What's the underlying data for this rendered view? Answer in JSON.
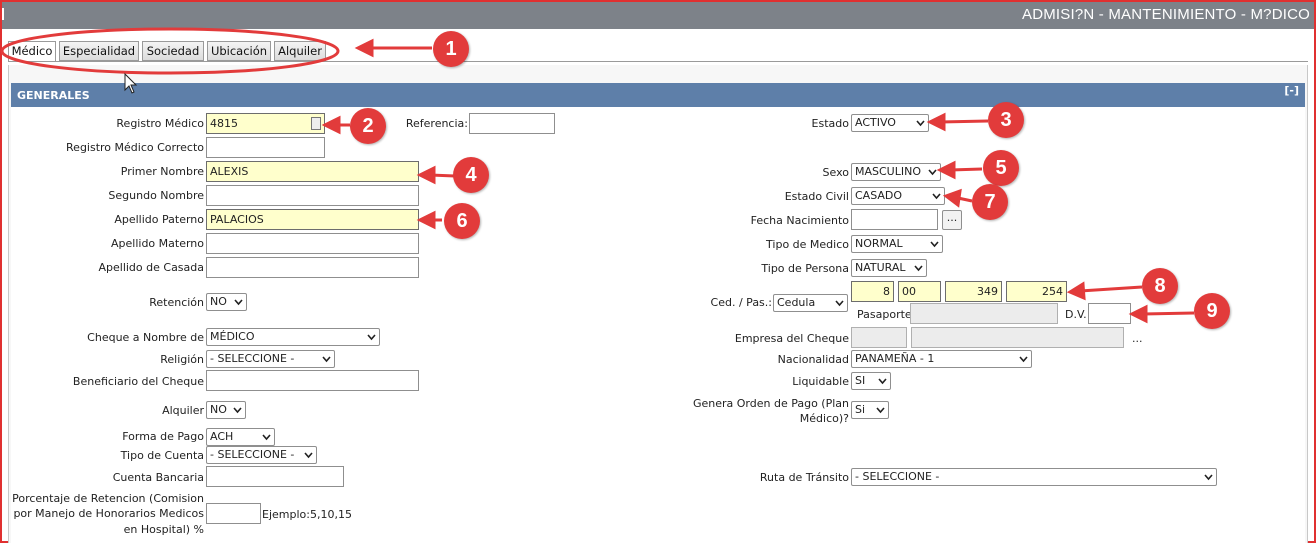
{
  "window": {
    "title": "ADMISI?N - MANTENIMIENTO - M?DICO"
  },
  "tabs": [
    {
      "label": "Médico",
      "active": true
    },
    {
      "label": "Especialidad"
    },
    {
      "label": "Sociedad"
    },
    {
      "label": "Ubicación"
    },
    {
      "label": "Alquiler"
    }
  ],
  "panel": {
    "title": "GENERALES",
    "collapse_label": "[-]"
  },
  "left": {
    "registro_medico": {
      "label": "Registro Médico",
      "value": "4815"
    },
    "referencia": {
      "label": "Referencia:",
      "value": ""
    },
    "registro_correcto": {
      "label": "Registro Médico Correcto",
      "value": ""
    },
    "primer_nombre": {
      "label": "Primer Nombre",
      "value": "ALEXIS"
    },
    "segundo_nombre": {
      "label": "Segundo Nombre",
      "value": ""
    },
    "apellido_paterno": {
      "label": "Apellido Paterno",
      "value": "PALACIOS"
    },
    "apellido_materno": {
      "label": "Apellido Materno",
      "value": ""
    },
    "apellido_casada": {
      "label": "Apellido de Casada",
      "value": ""
    },
    "retencion": {
      "label": "Retención",
      "value": "NO"
    },
    "cheque_nombre": {
      "label": "Cheque a Nombre de",
      "value": "MÉDICO"
    },
    "religion": {
      "label": "Religión",
      "value": "- SELECCIONE -"
    },
    "beneficiario": {
      "label": "Beneficiario del Cheque",
      "value": ""
    },
    "alquiler": {
      "label": "Alquiler",
      "value": "NO"
    },
    "forma_pago": {
      "label": "Forma de Pago",
      "value": "ACH"
    },
    "tipo_cuenta": {
      "label": "Tipo de Cuenta",
      "value": "- SELECCIONE -"
    },
    "cuenta_bancaria": {
      "label": "Cuenta Bancaria",
      "value": ""
    },
    "porcentaje": {
      "label_1": "Porcentaje de Retencion (Comision",
      "label_2": "por Manejo de Honorarios Medicos",
      "label_3": "en Hospital) %",
      "value": "",
      "ejemplo": "Ejemplo:5,10,15"
    }
  },
  "right": {
    "estado": {
      "label": "Estado",
      "value": "ACTIVO"
    },
    "sexo": {
      "label": "Sexo",
      "value": "MASCULINO"
    },
    "estado_civil": {
      "label": "Estado Civil",
      "value": "CASADO"
    },
    "fecha_nacimiento": {
      "label": "Fecha Nacimiento",
      "value": "",
      "button": "..."
    },
    "tipo_medico": {
      "label": "Tipo de Medico",
      "value": "NORMAL"
    },
    "tipo_persona": {
      "label": "Tipo de Persona",
      "value": "NATURAL"
    },
    "cedula": {
      "label": "Ced. / Pas.:",
      "type": "Cedula",
      "p1": "8",
      "p2": "00",
      "p3": "349",
      "p4": "254"
    },
    "pasaporte": {
      "label": "Pasaporte:",
      "value": "",
      "dv_label": "D.V.",
      "dv_value": ""
    },
    "empresa_cheque": {
      "label": "Empresa del Cheque",
      "code": "",
      "name": "",
      "dots": "..."
    },
    "nacionalidad": {
      "label": "Nacionalidad",
      "value": "PANAMEÑA - 1"
    },
    "liquidable": {
      "label": "Liquidable",
      "value": "SI"
    },
    "genera_orden": {
      "label_1": "Genera Orden de Pago (Plan",
      "label_2": "Médico)?",
      "value": "Si"
    },
    "ruta_transito": {
      "label": "Ruta de Tránsito",
      "value": "- SELECCIONE -"
    }
  },
  "callouts": [
    "1",
    "2",
    "3",
    "4",
    "5",
    "6",
    "7",
    "8",
    "9"
  ],
  "colors": {
    "accent": "#e23b3b",
    "header": "#5e7fa9",
    "titlebar": "#7d8289",
    "highlight": "#ffffcc"
  }
}
